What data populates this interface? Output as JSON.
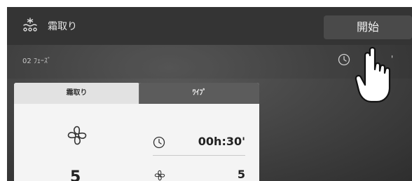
{
  "header": {
    "title": "霜取り",
    "icon": "defrost-icon",
    "start_label": "開始"
  },
  "subheader": {
    "phase_label": "02 ﾌｪｰｽﾞ",
    "clock_icon": "clock-icon",
    "clock_text_partial": "'"
  },
  "cards": [
    {
      "title": "霜取り",
      "icon": "fan-icon",
      "value": "5"
    },
    {
      "title": "ﾜｲﾌﾟ",
      "time_icon": "clock-icon",
      "time": "00h:30'",
      "fan_icon": "fan-icon",
      "fan_value": "5"
    }
  ],
  "overlay": {
    "icon": "pointing-hand-icon"
  },
  "colors": {
    "topbar": "#343434",
    "screen": "#4a4a4a",
    "card_bg": "#f4f4f4",
    "card_header_light": "#e2e2e2",
    "card_header_dark": "#5c5c5c"
  }
}
